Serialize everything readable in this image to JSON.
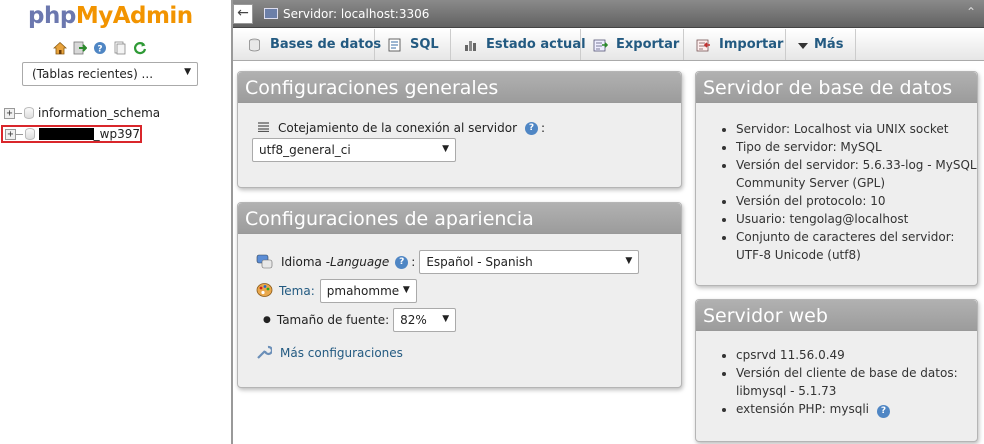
{
  "app": {
    "logo_php": "php",
    "logo_myadmin": "MyAdmin"
  },
  "nav": {
    "recent_tables": "(Tablas recientes) ...",
    "databases": [
      {
        "name": "information_schema",
        "redacted": false
      },
      {
        "name": "_wp397",
        "redacted": true
      }
    ],
    "icons": [
      "home-icon",
      "exit-icon",
      "help-icon",
      "docs-icon",
      "reload-icon"
    ]
  },
  "topbar": {
    "server_label": "Servidor: localhost:3306",
    "collapse_symbol": "←",
    "up_arrow": "⌃"
  },
  "menu": {
    "tabs": [
      {
        "label": "Bases de datos",
        "icon": "database-icon"
      },
      {
        "label": "SQL",
        "icon": "sql-icon"
      },
      {
        "label": "Estado actual",
        "icon": "status-icon"
      },
      {
        "label": "Exportar",
        "icon": "export-icon"
      },
      {
        "label": "Importar",
        "icon": "import-icon"
      },
      {
        "label": "Más",
        "icon": "more-icon"
      }
    ]
  },
  "general": {
    "title": "Configuraciones generales",
    "collation_label": "Cotejamiento de la conexión al servidor",
    "collation_suffix": ":",
    "collation_value": "utf8_general_ci"
  },
  "appearance": {
    "title": "Configuraciones de apariencia",
    "language_label": "Idioma - ",
    "language_label_italic": "Language",
    "language_suffix": ":",
    "language_value": "Español - Spanish",
    "theme_label": "Tema:",
    "theme_value": "pmahomme",
    "font_label": "Tamaño de fuente:",
    "font_value": "82%",
    "more_settings": "Más configuraciones"
  },
  "db_server": {
    "title": "Servidor de base de datos",
    "items": [
      "Servidor: Localhost via UNIX socket",
      "Tipo de servidor: MySQL",
      "Versión del servidor: 5.6.33-log - MySQL Community Server (GPL)",
      "Versión del protocolo: 10",
      "Usuario: tengolag@localhost",
      "Conjunto de caracteres del servidor: UTF-8 Unicode (utf8)"
    ]
  },
  "web_server": {
    "title": "Servidor web",
    "items": [
      "cpsrvd 11.56.0.49",
      "Versión del cliente de base de datos: libmysql - 5.1.73",
      "extensión PHP: mysqli"
    ]
  },
  "colors": {
    "accent_link": "#235a81",
    "logo_blue": "#6c78af",
    "logo_orange": "#f29400",
    "highlight_border": "#d9262b"
  }
}
